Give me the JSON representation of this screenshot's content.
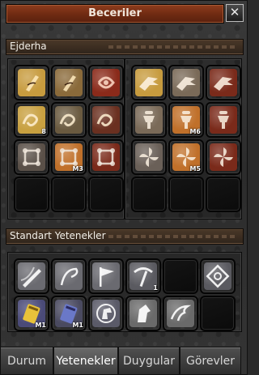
{
  "window": {
    "title": "Beceriler",
    "close_glyph": "✕"
  },
  "sections": {
    "dragon": {
      "label": "Ejderha"
    },
    "standard": {
      "label": "Standart Yetenekler"
    }
  },
  "dragon_left": [
    {
      "icon": "dragon-scroll-icon",
      "bg": "#c79b3e",
      "badge": ""
    },
    {
      "icon": "dragon-scroll-icon",
      "bg": "#8a6a3a",
      "badge": ""
    },
    {
      "icon": "dragon-coil-icon",
      "bg": "#8a2a1a",
      "badge": ""
    },
    {
      "icon": "dragon-swirl-icon",
      "bg": "#c8a040",
      "badge": "8"
    },
    {
      "icon": "dragon-swirl-icon",
      "bg": "#6a5a40",
      "badge": ""
    },
    {
      "icon": "dragon-swirl-icon",
      "bg": "#6a3020",
      "badge": ""
    },
    {
      "icon": "chain-knot-icon",
      "bg": "#5a5048",
      "badge": ""
    },
    {
      "icon": "chain-knot-icon",
      "bg": "#c0702a",
      "badge": "M3"
    },
    {
      "icon": "chain-knot-icon",
      "bg": "#7a2a1a",
      "badge": ""
    },
    {
      "icon": "",
      "bg": "",
      "badge": ""
    },
    {
      "icon": "",
      "bg": "",
      "badge": ""
    },
    {
      "icon": "",
      "bg": "",
      "badge": ""
    }
  ],
  "dragon_right": [
    {
      "icon": "dragon-head-icon",
      "bg": "#c79b3e",
      "badge": ""
    },
    {
      "icon": "dragon-head-icon",
      "bg": "#7a6a58",
      "badge": ""
    },
    {
      "icon": "dragon-head-icon",
      "bg": "#7a2a1a",
      "badge": ""
    },
    {
      "icon": "spinning-top-icon",
      "bg": "#7a6a58",
      "badge": ""
    },
    {
      "icon": "spinning-top-icon",
      "bg": "#c0702a",
      "badge": "M6"
    },
    {
      "icon": "spinning-top-icon",
      "bg": "#7a2a1a",
      "badge": ""
    },
    {
      "icon": "pinwheel-icon",
      "bg": "#6a6058",
      "badge": ""
    },
    {
      "icon": "pinwheel-icon",
      "bg": "#c0702a",
      "badge": "M5"
    },
    {
      "icon": "pinwheel-icon",
      "bg": "#7a2a1a",
      "badge": ""
    },
    {
      "icon": "",
      "bg": "",
      "badge": ""
    },
    {
      "icon": "",
      "bg": "",
      "badge": ""
    },
    {
      "icon": "",
      "bg": "",
      "badge": ""
    }
  ],
  "standard": [
    {
      "icon": "sword-slash-icon",
      "bg": "#6a6a70",
      "badge": ""
    },
    {
      "icon": "whip-icon",
      "bg": "#6a6a70",
      "badge": ""
    },
    {
      "icon": "flag-icon",
      "bg": "#6a6a70",
      "badge": ""
    },
    {
      "icon": "pickaxe-icon",
      "bg": "#5a5a60",
      "badge": "1"
    },
    {
      "icon": "",
      "bg": "",
      "badge": ""
    },
    {
      "icon": "knot-emblem-icon",
      "bg": "#5a5a60",
      "badge": ""
    },
    {
      "icon": "gold-book-icon",
      "bg": "#4a4a78",
      "badge": "M1"
    },
    {
      "icon": "blue-book-icon",
      "bg": "#4a4a60",
      "badge": "M1"
    },
    {
      "icon": "horse-emblem-icon",
      "bg": "#5a5a68",
      "badge": ""
    },
    {
      "icon": "horse-head-icon",
      "bg": "#6a6a6a",
      "badge": ""
    },
    {
      "icon": "horse-charge-icon",
      "bg": "#6a6a6a",
      "badge": ""
    },
    {
      "icon": "",
      "bg": "",
      "badge": ""
    }
  ],
  "tabs": [
    {
      "label": "Durum",
      "active": false
    },
    {
      "label": "Yetenekler",
      "active": true
    },
    {
      "label": "Duygular",
      "active": false
    },
    {
      "label": "Görevler",
      "active": false
    }
  ]
}
